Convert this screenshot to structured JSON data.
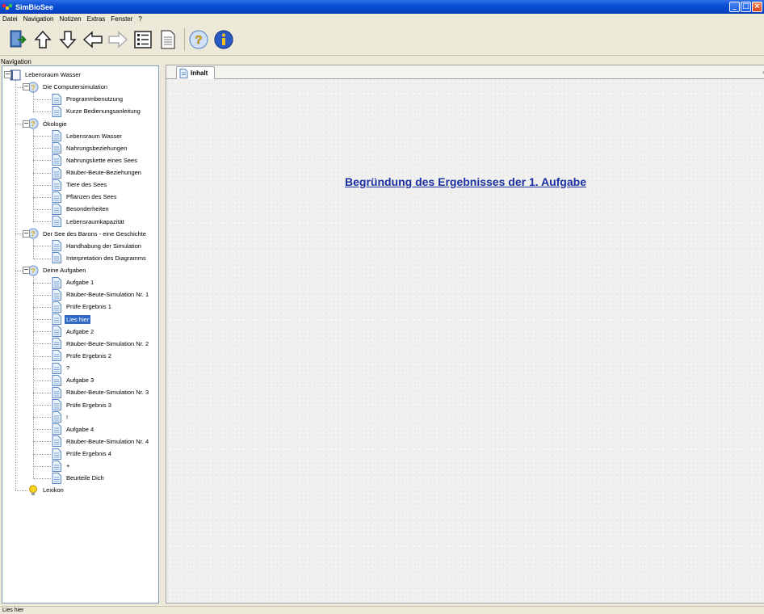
{
  "window": {
    "title": "SimBioSee"
  },
  "menu": [
    "Datei",
    "Navigation",
    "Notizen",
    "Extras",
    "Fenster",
    "?"
  ],
  "toolbar": {
    "buttons": [
      "exit-icon",
      "arrow-up-icon",
      "arrow-down-icon",
      "arrow-left-icon",
      "arrow-right-icon",
      "list-view-icon",
      "page-icon",
      "help-icon",
      "info-icon"
    ]
  },
  "navigation": {
    "label": "Navigation",
    "tree": [
      {
        "label": "Lebensraum Wasser",
        "type": "book",
        "level": 0,
        "expander": "−"
      },
      {
        "label": "Die Computersimulation",
        "type": "help",
        "level": 1,
        "expander": "−"
      },
      {
        "label": "Programmbenutzung",
        "type": "page",
        "level": 2
      },
      {
        "label": "Kurze Bedienungsanleitung",
        "type": "page",
        "level": 2
      },
      {
        "label": "Ökologie",
        "type": "help",
        "level": 1,
        "expander": "−"
      },
      {
        "label": "Lebensraum Wasser",
        "type": "page",
        "level": 2
      },
      {
        "label": "Nahrungsbeziehungen",
        "type": "page",
        "level": 2
      },
      {
        "label": "Nahrungskette eines Sees",
        "type": "page",
        "level": 2
      },
      {
        "label": "Räuber-Beute-Beziehungen",
        "type": "page",
        "level": 2
      },
      {
        "label": "Tiere des Sees",
        "type": "page",
        "level": 2
      },
      {
        "label": "Pflanzen des Sees",
        "type": "page",
        "level": 2
      },
      {
        "label": "Besonderheiten",
        "type": "page",
        "level": 2
      },
      {
        "label": "Lebensraumkapazität",
        "type": "page",
        "level": 2
      },
      {
        "label": "Der See des Barons - eine Geschichte",
        "type": "help",
        "level": 1,
        "expander": "−"
      },
      {
        "label": "Handhabung der Simulation",
        "type": "page",
        "level": 2
      },
      {
        "label": "Interpretation des Diagramms",
        "type": "page",
        "level": 2
      },
      {
        "label": "Deine Aufgaben",
        "type": "help",
        "level": 1,
        "expander": "−"
      },
      {
        "label": "Aufgabe 1",
        "type": "page",
        "level": 2
      },
      {
        "label": "Räuber-Beute-Simulation Nr. 1",
        "type": "page",
        "level": 2
      },
      {
        "label": "Prüfe Ergebnis 1",
        "type": "page",
        "level": 2
      },
      {
        "label": "Lies hier",
        "type": "page",
        "level": 2,
        "selected": true
      },
      {
        "label": "Aufgabe 2",
        "type": "page",
        "level": 2
      },
      {
        "label": "Räuber-Beute-Simulation Nr. 2",
        "type": "page",
        "level": 2
      },
      {
        "label": "Prüfe Ergebnis 2",
        "type": "page",
        "level": 2
      },
      {
        "label": "?",
        "type": "page",
        "level": 2
      },
      {
        "label": "Aufgabe 3",
        "type": "page",
        "level": 2
      },
      {
        "label": "Räuber-Beute-Simulation Nr. 3",
        "type": "page",
        "level": 2
      },
      {
        "label": "Prüfe Ergebnis 3",
        "type": "page",
        "level": 2
      },
      {
        "label": "!",
        "type": "page",
        "level": 2
      },
      {
        "label": "Aufgabe 4",
        "type": "page",
        "level": 2
      },
      {
        "label": "Räuber-Beute-Simulation Nr. 4",
        "type": "page",
        "level": 2
      },
      {
        "label": "Prüfe Ergebnis 4",
        "type": "page",
        "level": 2
      },
      {
        "label": "+",
        "type": "page",
        "level": 2
      },
      {
        "label": "Beurteile Dich",
        "type": "page",
        "level": 2
      },
      {
        "label": "Lexikon",
        "type": "bulb",
        "level": 1
      }
    ]
  },
  "content": {
    "tab_label": "Inhalt",
    "tab_end": "‹",
    "heading_link": "Begründung des Ergebnisses der 1. Aufgabe"
  },
  "status": {
    "text": "Lies hier"
  },
  "colors": {
    "titlebar": "#0a4fd6",
    "selection": "#316ac5",
    "link": "#1a2fa0"
  }
}
